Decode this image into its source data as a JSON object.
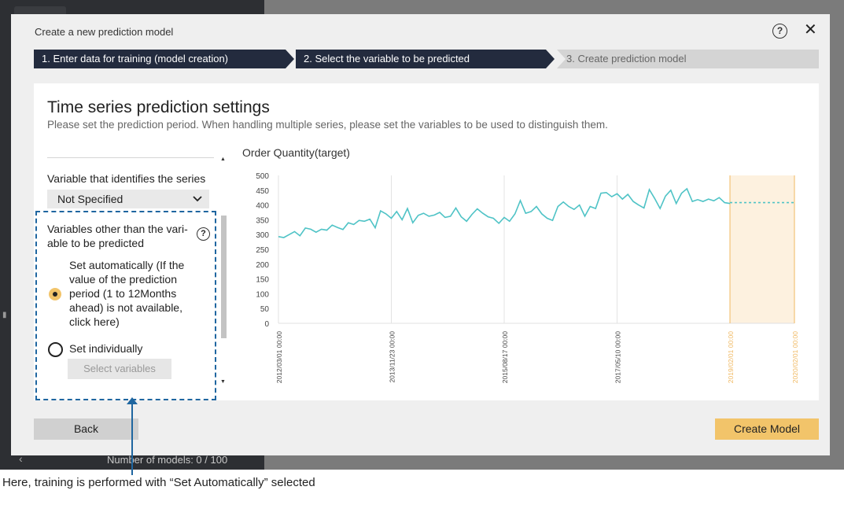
{
  "background": {
    "models_count": "Number of models: 0 / 100",
    "back_arrow": "‹"
  },
  "dialog": {
    "title": "Create a new prediction model",
    "help_glyph": "?",
    "close_glyph": "✕",
    "steps": [
      {
        "label": "1. Enter data for training (model creation)",
        "state": "done"
      },
      {
        "label": "2. Select the variable to be predicted",
        "state": "active"
      },
      {
        "label": "3. Create prediction model",
        "state": "pending"
      }
    ],
    "panel": {
      "title": "Time series prediction settings",
      "subtitle": "Please set the prediction period. When handling multiple series, please set the variables to be used to distinguish them."
    },
    "settings": {
      "series_label": "Variable that identifies the series",
      "series_value": "Not Specified",
      "chevron_icon": "chevron-down-icon",
      "vars_label": "Variables other than the vari-able to be predicted",
      "vars_help": "?",
      "options": [
        {
          "label": "Set automatically (If the value of the prediction period (1 to 12Months ahead) is not available, click here)",
          "selected": true
        },
        {
          "label": "Set individually",
          "selected": false
        }
      ],
      "select_variables_label": "Select variables"
    },
    "footer": {
      "back_label": "Back",
      "create_label": "Create Model"
    }
  },
  "callout": {
    "text": "Here, training is performed with “Set Automatically” selected"
  },
  "colors": {
    "step_active": "#232b3e",
    "step_pending": "#d4d4d4",
    "accent": "#f2c46a",
    "series_line": "#4fc3c6",
    "forecast_band": "#fdf1df",
    "forecast_tick": "#f0b860",
    "callout": "#1f66a0"
  },
  "chart_data": {
    "type": "line",
    "title": "Order Quantity(target)",
    "ylim": [
      0,
      500
    ],
    "yticks": [
      0,
      50,
      100,
      150,
      200,
      250,
      300,
      350,
      400,
      450,
      500
    ],
    "x_tick_labels": [
      "2012/03/01 00:00",
      "2013/11/23 00:00",
      "2015/08/17 00:00",
      "2017/05/10 00:00",
      "2019/02/01 00:00",
      "2020/02/01 00:00"
    ],
    "x_tick_positions": [
      0,
      21,
      42,
      63,
      84,
      96
    ],
    "forecast_start": 84,
    "forecast_end": 96,
    "forecast_level": 408,
    "grid": "vertical",
    "series": [
      {
        "values": [
          293,
          290,
          300,
          310,
          296,
          322,
          318,
          308,
          318,
          315,
          332,
          324,
          317,
          340,
          334,
          348,
          345,
          352,
          323,
          380,
          370,
          355,
          378,
          350,
          388,
          340,
          365,
          372,
          362,
          366,
          375,
          358,
          362,
          390,
          360,
          345,
          368,
          387,
          372,
          360,
          355,
          338,
          358,
          345,
          370,
          415,
          372,
          378,
          395,
          370,
          355,
          348,
          395,
          410,
          395,
          385,
          400,
          362,
          395,
          388,
          440,
          442,
          428,
          438,
          420,
          436,
          412,
          400,
          390,
          452,
          422,
          388,
          430,
          450,
          405,
          440,
          455,
          412,
          418,
          412,
          420,
          414,
          425,
          408,
          405
        ]
      }
    ]
  }
}
